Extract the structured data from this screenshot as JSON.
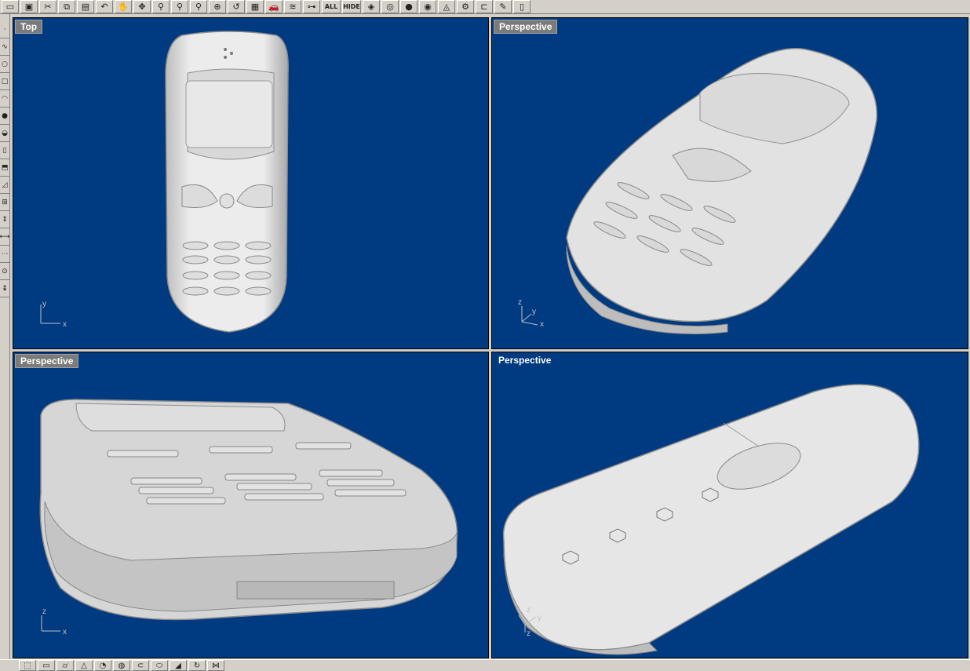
{
  "app": {
    "toolbar_top": {
      "items": [
        {
          "icon": "new-file-icon",
          "glyph": "▭"
        },
        {
          "icon": "save-icon",
          "glyph": "▣"
        },
        {
          "icon": "cut-icon",
          "glyph": "✂"
        },
        {
          "icon": "copy-icon",
          "glyph": "⧉"
        },
        {
          "icon": "paste-icon",
          "glyph": "▤"
        },
        {
          "icon": "undo-icon",
          "glyph": "↶"
        },
        {
          "icon": "pan-hand-icon",
          "glyph": "✋"
        },
        {
          "icon": "rotate-view-icon",
          "glyph": "✥"
        },
        {
          "icon": "zoom-dynamic-icon",
          "glyph": "⚲"
        },
        {
          "icon": "zoom-window-icon",
          "glyph": "⚲"
        },
        {
          "icon": "zoom-selected-icon",
          "glyph": "⚲"
        },
        {
          "icon": "zoom-extents-icon",
          "glyph": "⊕"
        },
        {
          "icon": "zoom-previous-icon",
          "glyph": "↺"
        },
        {
          "icon": "grid-icon",
          "glyph": "▦"
        },
        {
          "icon": "car-render-icon",
          "glyph": "🚗"
        },
        {
          "icon": "layers-icon",
          "glyph": "≋"
        },
        {
          "icon": "point-on-icon",
          "glyph": "⊶"
        },
        {
          "icon": "show-all-icon",
          "text": "ALL"
        },
        {
          "icon": "hide-icon",
          "text": "HIDE"
        },
        {
          "icon": "layer-stack-icon",
          "glyph": "◈"
        },
        {
          "icon": "color-wheel-icon",
          "glyph": "◎"
        },
        {
          "icon": "shaded-sphere-icon",
          "glyph": "●"
        },
        {
          "icon": "rendered-sphere-icon",
          "glyph": "◉"
        },
        {
          "icon": "light-icon",
          "glyph": "◬"
        },
        {
          "icon": "settings-gear-icon",
          "glyph": "⚙"
        },
        {
          "icon": "dimension-icon",
          "glyph": "⊏"
        },
        {
          "icon": "notes-icon",
          "glyph": "✎"
        },
        {
          "icon": "document-icon",
          "glyph": "▯"
        }
      ]
    },
    "toolbar_left": {
      "items": [
        {
          "icon": "point-icon",
          "glyph": "·"
        },
        {
          "icon": "curve-icon",
          "glyph": "∿"
        },
        {
          "icon": "circle-icon",
          "glyph": "○"
        },
        {
          "icon": "rectangle-icon",
          "glyph": "□"
        },
        {
          "icon": "arc-icon",
          "glyph": "◠"
        },
        {
          "icon": "sphere-icon",
          "glyph": "●"
        },
        {
          "icon": "surface-icon",
          "glyph": "◒"
        },
        {
          "icon": "box-icon",
          "glyph": "▯"
        },
        {
          "icon": "extrude-icon",
          "glyph": "⬒"
        },
        {
          "icon": "fillet-icon",
          "glyph": "◿"
        },
        {
          "icon": "boolean-icon",
          "glyph": "⊞"
        },
        {
          "icon": "transform-icon",
          "glyph": "⇕"
        },
        {
          "icon": "mirror-icon",
          "glyph": "⟷"
        },
        {
          "icon": "array-icon",
          "glyph": "⋯"
        },
        {
          "icon": "analyze-icon",
          "glyph": "⊙"
        },
        {
          "icon": "dimension-vertical-icon",
          "glyph": "↨"
        }
      ]
    },
    "toolbar_bottom": {
      "items": [
        {
          "icon": "cube-view-icon",
          "glyph": "⬚"
        },
        {
          "icon": "top-view-icon",
          "glyph": "▭"
        },
        {
          "icon": "cylinder-icon",
          "glyph": "⌭"
        },
        {
          "icon": "cone-icon",
          "glyph": "△"
        },
        {
          "icon": "sphere-small-icon",
          "glyph": "◔"
        },
        {
          "icon": "torus-icon",
          "glyph": "◍"
        },
        {
          "icon": "pipe-icon",
          "glyph": "⊂"
        },
        {
          "icon": "ellipsoid-icon",
          "glyph": "⬭"
        },
        {
          "icon": "wedge-icon",
          "glyph": "◢"
        },
        {
          "icon": "revolve-icon",
          "glyph": "↻"
        },
        {
          "icon": "loft-icon",
          "glyph": "⋈"
        }
      ]
    },
    "viewports": [
      {
        "label": "Top",
        "axes": [
          "y",
          "x"
        ]
      },
      {
        "label": "Perspective",
        "axes": [
          "z",
          "y",
          "x"
        ]
      },
      {
        "label": "Perspective",
        "axes": [
          "z",
          "x"
        ]
      },
      {
        "label": "Perspective",
        "axes": [
          "z",
          "y",
          "z"
        ]
      }
    ],
    "colors": {
      "viewport_bg": "#003a80",
      "model": "#e6e6e6",
      "model_shadow": "#9a9a9a",
      "label_bg": "#7b7b7b"
    }
  }
}
